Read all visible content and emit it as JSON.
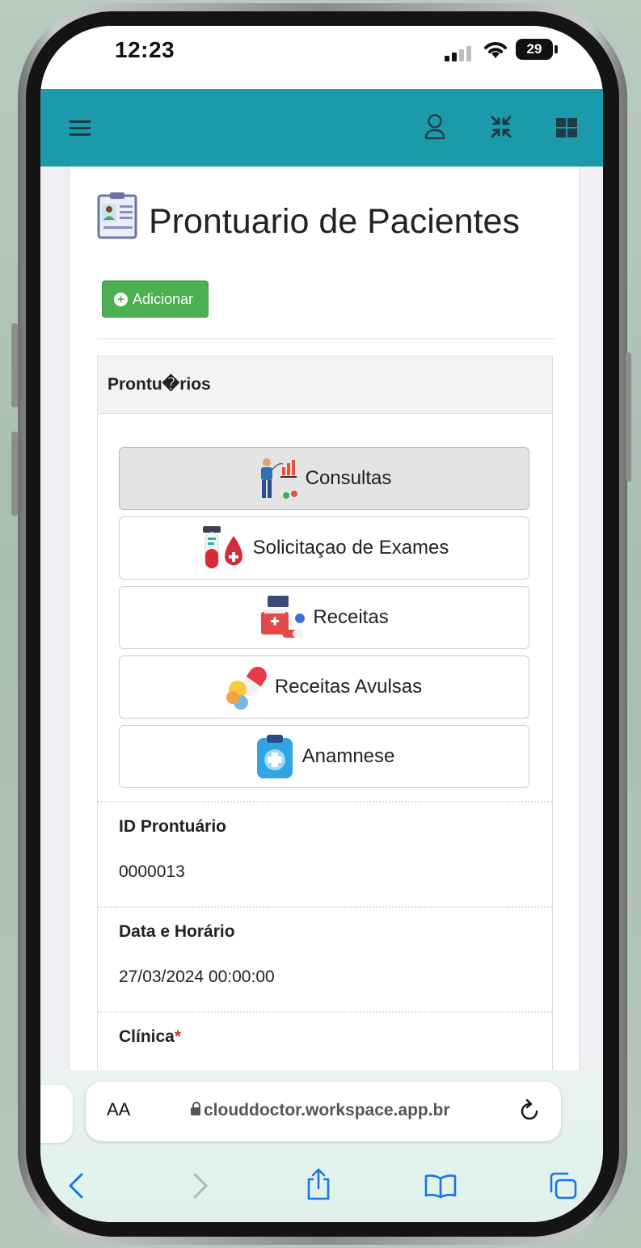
{
  "status_bar": {
    "time": "12:23",
    "battery": "29"
  },
  "topbar": {
    "color": "#1a9aaa",
    "icons": [
      "menu-icon",
      "user-icon",
      "collapse-icon",
      "grid-icon"
    ]
  },
  "page": {
    "title": "Prontuario de Pacientes",
    "add_button_label": "Adicionar",
    "accent_green": "#4caf50"
  },
  "panel": {
    "header": "Prontu�rios",
    "menu": [
      {
        "label": "Consultas",
        "icon": "consultation-icon",
        "active": true
      },
      {
        "label": "Solicitaçao de Exames",
        "icon": "blood-test-icon",
        "active": false
      },
      {
        "label": "Receitas",
        "icon": "prescription-kit-icon",
        "active": false
      },
      {
        "label": "Receitas Avulsas",
        "icon": "pills-icon",
        "active": false
      },
      {
        "label": "Anamnese",
        "icon": "clipboard-icon",
        "active": false
      }
    ],
    "fields": [
      {
        "label": "ID Prontuário",
        "value": "0000013"
      },
      {
        "label": "Data e Horário",
        "value": "27/03/2024 00:00:00"
      },
      {
        "label": "Clínica",
        "required_mark": "*"
      }
    ]
  },
  "browser": {
    "aa_label": "AA",
    "url": "clouddoctor.workspace.app.br",
    "icons": [
      "back-icon",
      "forward-icon",
      "share-icon",
      "bookmarks-icon",
      "tabs-icon"
    ]
  }
}
